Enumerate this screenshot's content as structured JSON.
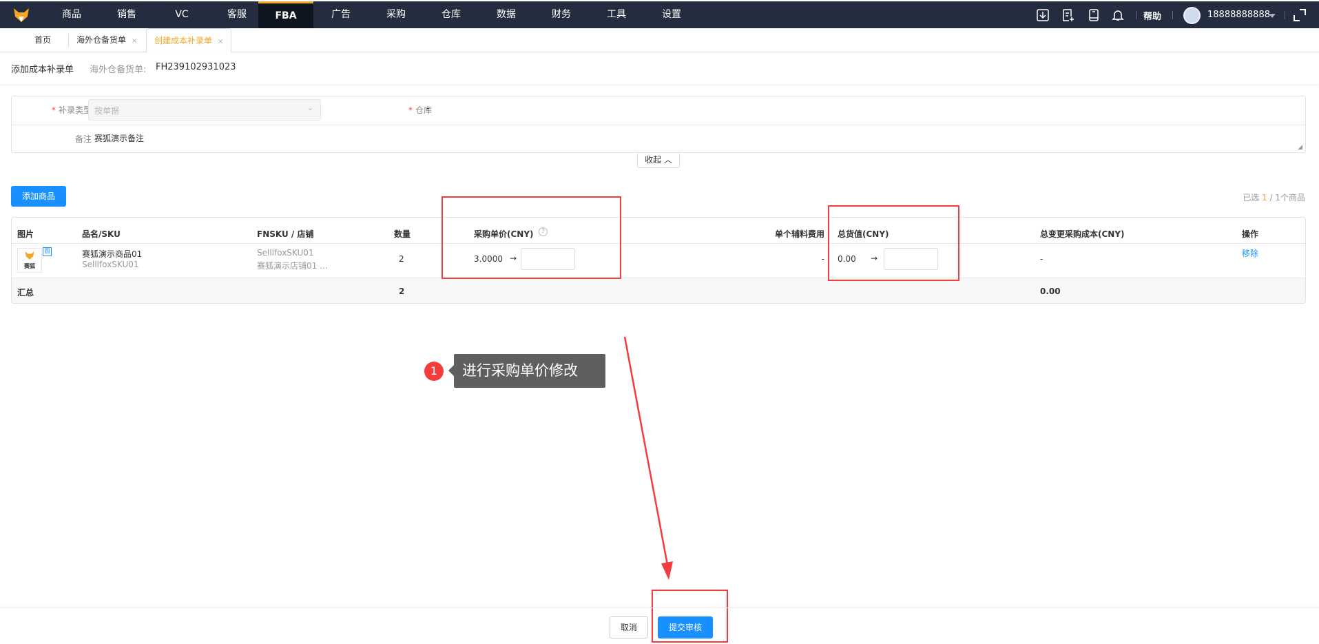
{
  "nav": {
    "items": [
      "商品",
      "销售",
      "VC",
      "客服",
      "FBA",
      "广告",
      "采购",
      "仓库",
      "数据",
      "财务",
      "工具",
      "设置"
    ],
    "active": "FBA",
    "help": "帮助",
    "user": "18888888888"
  },
  "tabs": [
    {
      "label": "首页"
    },
    {
      "label": "海外仓备货单",
      "close": "×"
    },
    {
      "label": "创建成本补录单",
      "close": "×"
    }
  ],
  "header": {
    "title": "添加成本补录单",
    "ref_label": "海外仓备货单:",
    "ref_value": "FH239102931023"
  },
  "form": {
    "type_label": "补录类型",
    "type_placeholder": "按单据",
    "warehouse_label": "仓库",
    "warehouse_value": "-",
    "note_label": "备注",
    "note_value": "赛狐演示备注",
    "collapse": "收起"
  },
  "toolbar": {
    "add_product": "添加商品",
    "selected_prefix": "已选",
    "selected_count": "1",
    "selected_suffix": "/ 1个商品"
  },
  "table": {
    "headers": [
      "图片",
      "品名/SKU",
      "FNSKU / 店铺",
      "数量",
      "采购单价(CNY)",
      "单个辅料费用",
      "总货值(CNY)",
      "总变更采购成本(CNY)",
      "操作"
    ],
    "rows": [
      {
        "thumb_text": "赛狐",
        "name": "赛狐演示商品01",
        "sku": "SelllfoxSKU01",
        "fnsku": "SelllfoxSKU01",
        "shop": "赛狐演示店铺01 ...",
        "qty": "2",
        "unit_price": "3.0000",
        "arrow": "→",
        "aux_fee": "-",
        "total_value": "0.00",
        "total_change": "-",
        "action": "移除"
      }
    ],
    "summary": {
      "label": "汇总",
      "qty": "2",
      "total_change": "0.00"
    }
  },
  "annotation": {
    "step": "1",
    "text": "进行采购单价修改"
  },
  "footer": {
    "cancel": "取消",
    "submit": "提交审核"
  },
  "colors": {
    "accent": "#1890ff",
    "nav_bg": "#232d3f",
    "orange": "#f5a623",
    "red": "#f33c3c"
  }
}
